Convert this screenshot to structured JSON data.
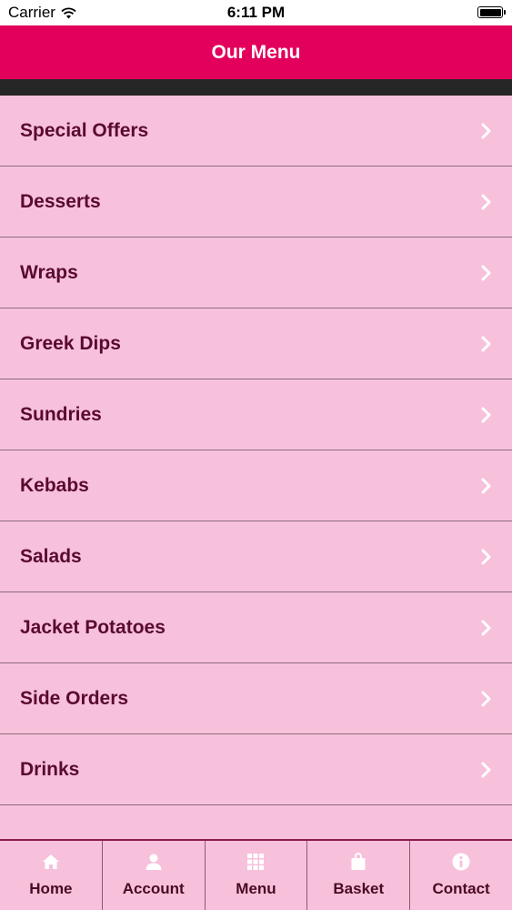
{
  "status_bar": {
    "carrier": "Carrier",
    "time": "6:11 PM"
  },
  "header": {
    "title": "Our Menu"
  },
  "menu": {
    "items": [
      {
        "label": "Special Offers"
      },
      {
        "label": "Desserts"
      },
      {
        "label": "Wraps"
      },
      {
        "label": "Greek Dips"
      },
      {
        "label": "Sundries"
      },
      {
        "label": "Kebabs"
      },
      {
        "label": "Salads"
      },
      {
        "label": "Jacket Potatoes"
      },
      {
        "label": "Side Orders"
      },
      {
        "label": "Drinks"
      }
    ]
  },
  "tabs": [
    {
      "label": "Home",
      "icon": "home-icon"
    },
    {
      "label": "Account",
      "icon": "user-icon"
    },
    {
      "label": "Menu",
      "icon": "grid-icon"
    },
    {
      "label": "Basket",
      "icon": "basket-icon"
    },
    {
      "label": "Contact",
      "icon": "info-icon"
    }
  ],
  "colors": {
    "header_bg": "#e3005c",
    "list_bg": "#f7c1dc",
    "text": "#5a0a2e"
  }
}
